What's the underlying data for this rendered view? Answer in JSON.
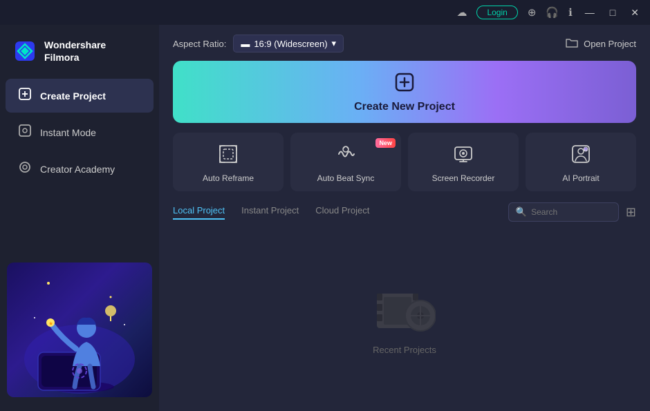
{
  "titlebar": {
    "login_label": "Login",
    "minimize": "—",
    "maximize": "□",
    "close": "✕"
  },
  "logo": {
    "brand_name": "Wondershare\nFilmora"
  },
  "sidebar": {
    "items": [
      {
        "id": "create-project",
        "label": "Create Project",
        "icon": "⊞",
        "active": true
      },
      {
        "id": "instant-mode",
        "label": "Instant Mode",
        "icon": "⊟",
        "active": false
      },
      {
        "id": "creator-academy",
        "label": "Creator Academy",
        "icon": "◎",
        "active": false
      }
    ]
  },
  "top_bar": {
    "aspect_label": "Aspect Ratio:",
    "aspect_value": "16:9 (Widescreen)",
    "open_project_label": "Open Project"
  },
  "create_banner": {
    "label": "Create New Project",
    "icon": "⊕"
  },
  "feature_cards": [
    {
      "id": "auto-reframe",
      "label": "Auto Reframe",
      "icon": "⬚",
      "new": false
    },
    {
      "id": "auto-beat-sync",
      "label": "Auto Beat Sync",
      "icon": "♫",
      "new": true
    },
    {
      "id": "screen-recorder",
      "label": "Screen Recorder",
      "icon": "⊡",
      "new": false
    },
    {
      "id": "ai-portrait",
      "label": "AI Portrait",
      "icon": "◈",
      "new": false
    }
  ],
  "new_badge_label": "New",
  "project_section": {
    "tabs": [
      {
        "id": "local",
        "label": "Local Project",
        "active": true
      },
      {
        "id": "instant",
        "label": "Instant Project",
        "active": false
      },
      {
        "id": "cloud",
        "label": "Cloud Project",
        "active": false
      }
    ],
    "search_placeholder": "Search",
    "empty_text": "Recent Projects"
  }
}
